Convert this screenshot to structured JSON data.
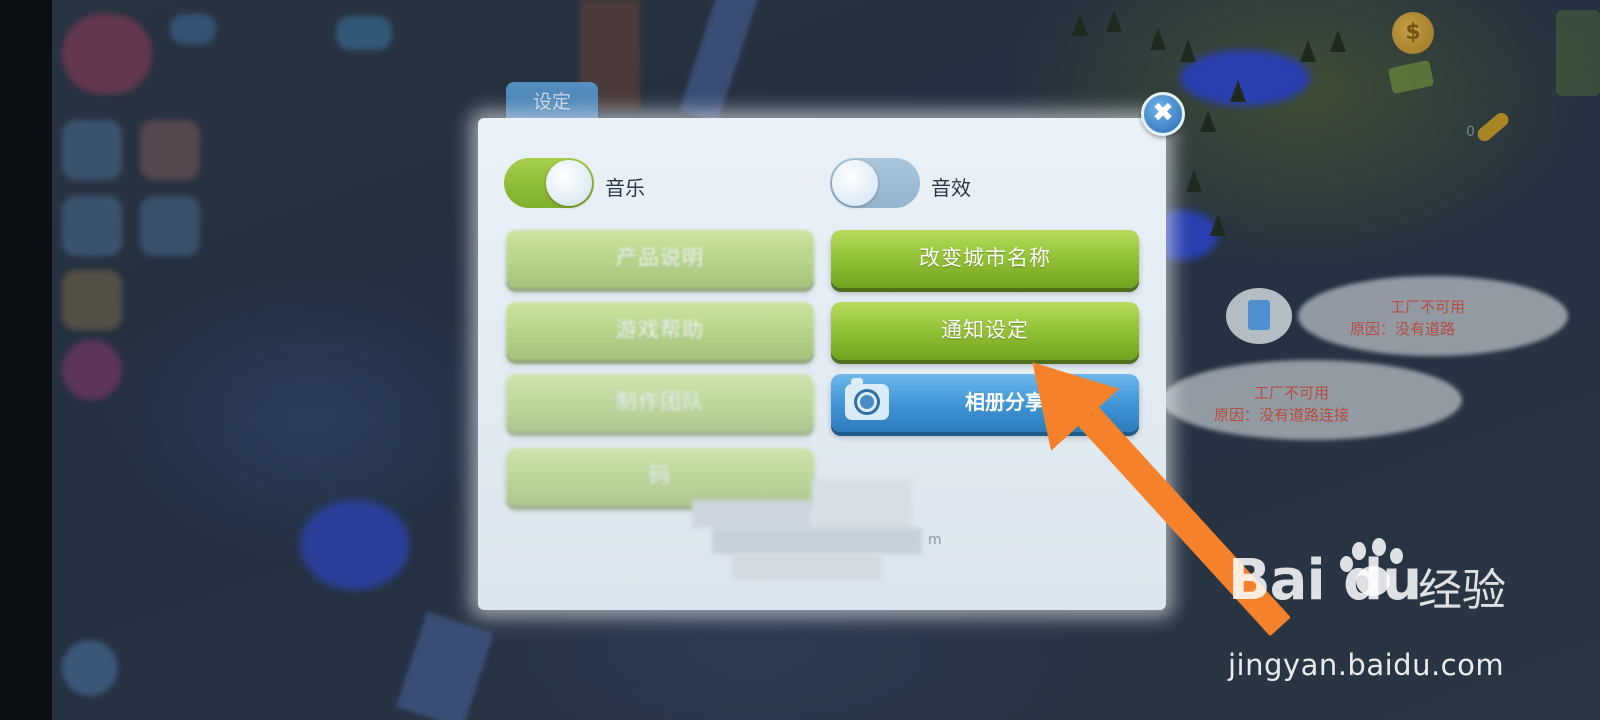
{
  "game": {
    "coin_glyph": "$",
    "key_count": "0",
    "thought_bubble_1": {
      "line1": "工厂不可用",
      "line2": "原因：没有道路"
    },
    "thought_bubble_2": {
      "line1": "工厂不可用",
      "line2": "原因：没有道路连接"
    }
  },
  "settings": {
    "tab_label": "设定",
    "close_glyph": "✖",
    "music": {
      "label": "音乐",
      "state": "on"
    },
    "sound_effects": {
      "label": "音效",
      "state": "off"
    },
    "buttons": {
      "product_info": "产品说明",
      "rename_city": "改变城市名称",
      "game_help": "游戏帮助",
      "notification_settings": "通知设定",
      "credits": "制作团队",
      "album_share": "相册分享",
      "code": "码"
    },
    "redacted_tail": "m"
  },
  "colors": {
    "green_button": "#8fbe32",
    "blue_button": "#3e93d4",
    "arrow": "#f5822a",
    "dialog": "#eaf1f7"
  },
  "watermark": {
    "brand": "Bai du",
    "brand_cn": "经验",
    "url": "jingyan.baidu.com"
  }
}
